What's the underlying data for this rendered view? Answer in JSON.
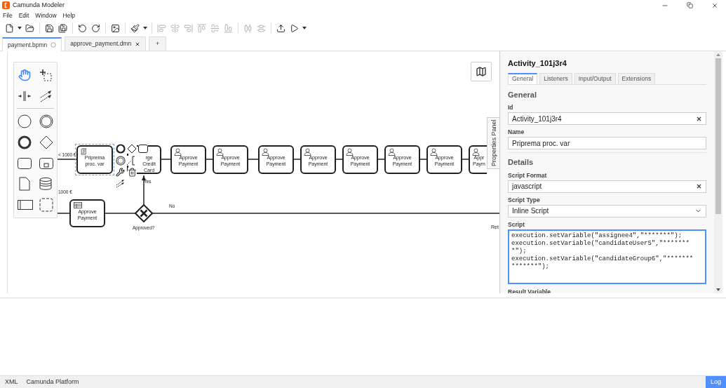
{
  "window": {
    "title": "Camunda Modeler"
  },
  "menu": [
    "File",
    "Edit",
    "Window",
    "Help"
  ],
  "tabs": [
    {
      "label": "payment.bpmn",
      "selected": true,
      "unsaved": true
    },
    {
      "label": "approve_payment.dmn",
      "selected": false,
      "unsaved": false
    }
  ],
  "new_tab": "+",
  "diagram": {
    "upper_condition": "< 1000 €",
    "lower_condition": "1000 €",
    "yes_label": "Yes",
    "no_label": "No",
    "return_label": "Ret",
    "script_task": {
      "label": "Priprema proc. var",
      "selected": true
    },
    "cut_task": {
      "label": "rge Credit Card"
    },
    "user_tasks": [
      {
        "label": "Approve Payment"
      },
      {
        "label": "Approve Payment"
      },
      {
        "label": "Approve Payment"
      },
      {
        "label": "Approve Payment"
      },
      {
        "label": "Approve Payment"
      },
      {
        "label": "Approve Payment"
      },
      {
        "label": "Approve Payment"
      },
      {
        "label": "Appr Paym"
      }
    ],
    "rule_task": {
      "label": "Approve Payment"
    },
    "gateway": {
      "label": "Approved?"
    },
    "panel_toggle": "Properties Panel"
  },
  "properties": {
    "title": "Activity_101j3r4",
    "tabs": [
      {
        "label": "General",
        "selected": true
      },
      {
        "label": "Listeners",
        "selected": false
      },
      {
        "label": "Input/Output",
        "selected": false
      },
      {
        "label": "Extensions",
        "selected": false
      }
    ],
    "groups": [
      {
        "title": "General",
        "fields": [
          {
            "kind": "text",
            "label": "Id",
            "value": "Activity_101j3r4"
          },
          {
            "kind": "textarea",
            "label": "Name",
            "value": "Priprema proc. var"
          }
        ]
      },
      {
        "title": "Details",
        "fields": [
          {
            "kind": "text",
            "label": "Script Format",
            "value": "javascript"
          },
          {
            "kind": "select",
            "label": "Script Type",
            "value": "Inline Script"
          },
          {
            "kind": "code",
            "label": "Script",
            "value": "execution.setVariable(\"assignee4\",\"*******\");\nexecution.setVariable(\"candidateUser5\",\"********\");\nexecution.setVariable(\"candidateGroup6\",\"**************\");"
          },
          {
            "kind": "label",
            "label": "Result Variable"
          }
        ]
      }
    ]
  },
  "status_bar": {
    "items": [
      "XML",
      "Camunda Platform"
    ],
    "log": "Log"
  }
}
